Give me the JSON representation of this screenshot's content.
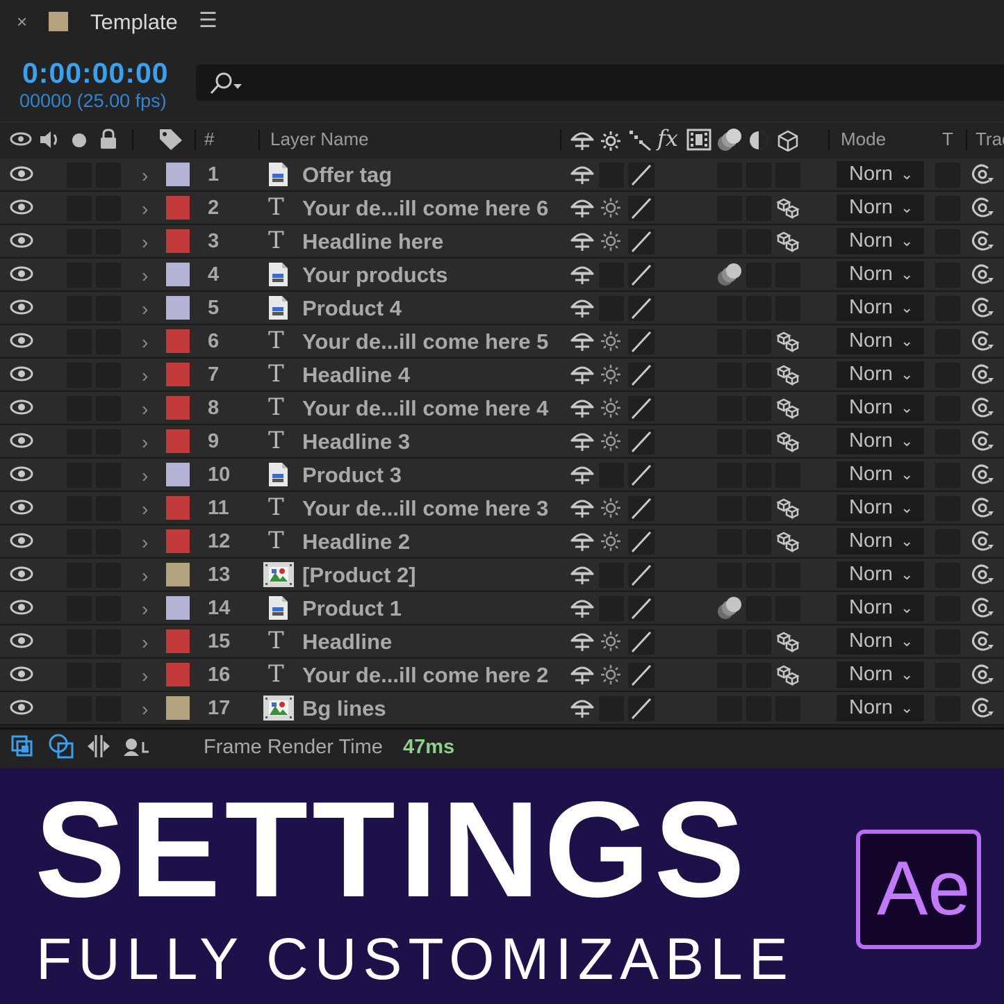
{
  "tab": {
    "close": "×",
    "title": "Template",
    "menu": "☰",
    "swatch_color": "#b5a27e"
  },
  "time": {
    "timecode": "0:00:00:00",
    "frames": "00000 (25.00 fps)"
  },
  "headers": {
    "number": "#",
    "layer_name": "Layer Name",
    "fx": "fx",
    "mode": "Mode",
    "t": "T",
    "track": "Trac"
  },
  "layers": [
    {
      "num": "1",
      "name": "Offer tag",
      "kind": "file",
      "color": "#b3b4d6",
      "sun": false,
      "blend": false,
      "cube": false
    },
    {
      "num": "2",
      "name": "Your de...ill come here 6",
      "kind": "text",
      "color": "#c23a3a",
      "sun": true,
      "blend": false,
      "cube": true
    },
    {
      "num": "3",
      "name": "Headline here",
      "kind": "text",
      "color": "#c23a3a",
      "sun": true,
      "blend": false,
      "cube": true
    },
    {
      "num": "4",
      "name": "Your products",
      "kind": "file",
      "color": "#b3b4d6",
      "sun": false,
      "blend": true,
      "cube": false
    },
    {
      "num": "5",
      "name": "Product 4",
      "kind": "file",
      "color": "#b3b4d6",
      "sun": false,
      "blend": false,
      "cube": false
    },
    {
      "num": "6",
      "name": "Your de...ill come here 5",
      "kind": "text",
      "color": "#c23a3a",
      "sun": true,
      "blend": false,
      "cube": true
    },
    {
      "num": "7",
      "name": "Headline 4",
      "kind": "text",
      "color": "#c23a3a",
      "sun": true,
      "blend": false,
      "cube": true
    },
    {
      "num": "8",
      "name": "Your de...ill come here 4",
      "kind": "text",
      "color": "#c23a3a",
      "sun": true,
      "blend": false,
      "cube": true
    },
    {
      "num": "9",
      "name": "Headline 3",
      "kind": "text",
      "color": "#c23a3a",
      "sun": true,
      "blend": false,
      "cube": true
    },
    {
      "num": "10",
      "name": "Product 3",
      "kind": "file",
      "color": "#b3b4d6",
      "sun": false,
      "blend": false,
      "cube": false
    },
    {
      "num": "11",
      "name": "Your de...ill come here 3",
      "kind": "text",
      "color": "#c23a3a",
      "sun": true,
      "blend": false,
      "cube": true
    },
    {
      "num": "12",
      "name": "Headline 2",
      "kind": "text",
      "color": "#c23a3a",
      "sun": true,
      "blend": false,
      "cube": true
    },
    {
      "num": "13",
      "name": "[Product 2]",
      "kind": "image",
      "color": "#b5a27e",
      "sun": false,
      "blend": false,
      "cube": false
    },
    {
      "num": "14",
      "name": "Product 1",
      "kind": "file",
      "color": "#b3b4d6",
      "sun": false,
      "blend": true,
      "cube": false
    },
    {
      "num": "15",
      "name": "Headline",
      "kind": "text",
      "color": "#c23a3a",
      "sun": true,
      "blend": false,
      "cube": true
    },
    {
      "num": "16",
      "name": "Your de...ill come here 2",
      "kind": "text",
      "color": "#c23a3a",
      "sun": true,
      "blend": false,
      "cube": true
    },
    {
      "num": "17",
      "name": "Bg lines",
      "kind": "image",
      "color": "#b5a27e",
      "sun": false,
      "blend": false,
      "cube": false
    }
  ],
  "mode_value": "Norn",
  "footer": {
    "label": "Frame Render Time",
    "value": "47ms"
  },
  "banner": {
    "title": "SETTINGS",
    "subtitle": "FULLY CUSTOMIZABLE",
    "logo": "Ae"
  }
}
